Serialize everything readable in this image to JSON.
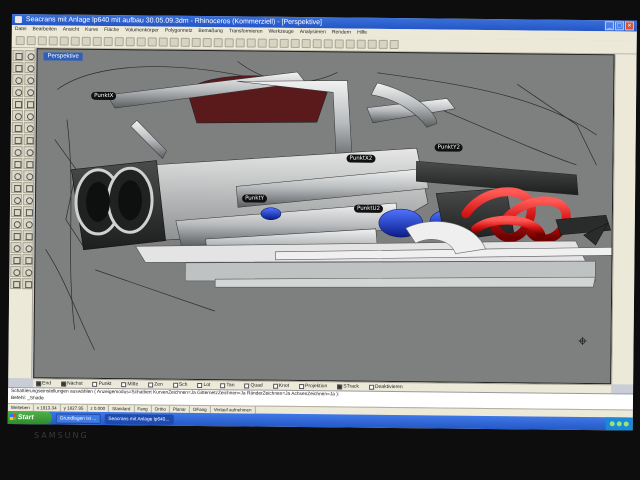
{
  "window": {
    "title": "Seacrans mit Anlage lp640 mit aufbau 30.05.09.3dm - Rhinoceros (Kommerziell) - [Perspektive]"
  },
  "menubar": {
    "items": [
      "Datei",
      "Bearbeiten",
      "Ansicht",
      "Kurve",
      "Fläche",
      "Volumenkörper",
      "Polygonnetz",
      "Bemaßung",
      "Transformieren",
      "Werkzeuge",
      "Analysieren",
      "Rendern",
      "Hilfe"
    ]
  },
  "viewport": {
    "title": "Perspektive",
    "labels": [
      "PunktX",
      "PunktX2",
      "PunktY",
      "PunktU2",
      "PunktY2"
    ]
  },
  "osnap": {
    "items": [
      {
        "label": "End",
        "checked": true
      },
      {
        "label": "Nächst",
        "checked": true
      },
      {
        "label": "Punkt",
        "checked": false
      },
      {
        "label": "Mitte",
        "checked": false
      },
      {
        "label": "Zen",
        "checked": false
      },
      {
        "label": "Sch",
        "checked": false
      },
      {
        "label": "Lot",
        "checked": false
      },
      {
        "label": "Tan",
        "checked": false
      },
      {
        "label": "Quad",
        "checked": false
      },
      {
        "label": "Knot",
        "checked": false
      },
      {
        "label": "Projektion",
        "checked": false
      },
      {
        "label": "STrack",
        "checked": true
      },
      {
        "label": "Deaktivieren",
        "checked": false
      }
    ]
  },
  "command": {
    "line1": "Schattierungseinstellungen auswählen ( Anzeigemodus=Schattiert  KurvenZeichnen=Ja  GitternetzZeichnen=Ja  RänderZeichnen=Ja  AchsenZeichnen=Ja ):",
    "line2": "Befehl: _Shade"
  },
  "status": {
    "cells": [
      "Welteben",
      "x 1913.34",
      "y 1827.95",
      "z 0.000",
      "Standard",
      "Fang",
      "Ortho",
      "Planar",
      "OFang",
      "Verlauf aufnehmen"
    ]
  },
  "taskbar": {
    "start": "Start",
    "tasks": [
      "Grundlagen ist ...",
      "Seacrans mit Anlage lp640..."
    ]
  },
  "monitor": {
    "brand": "SAMSUNG"
  }
}
